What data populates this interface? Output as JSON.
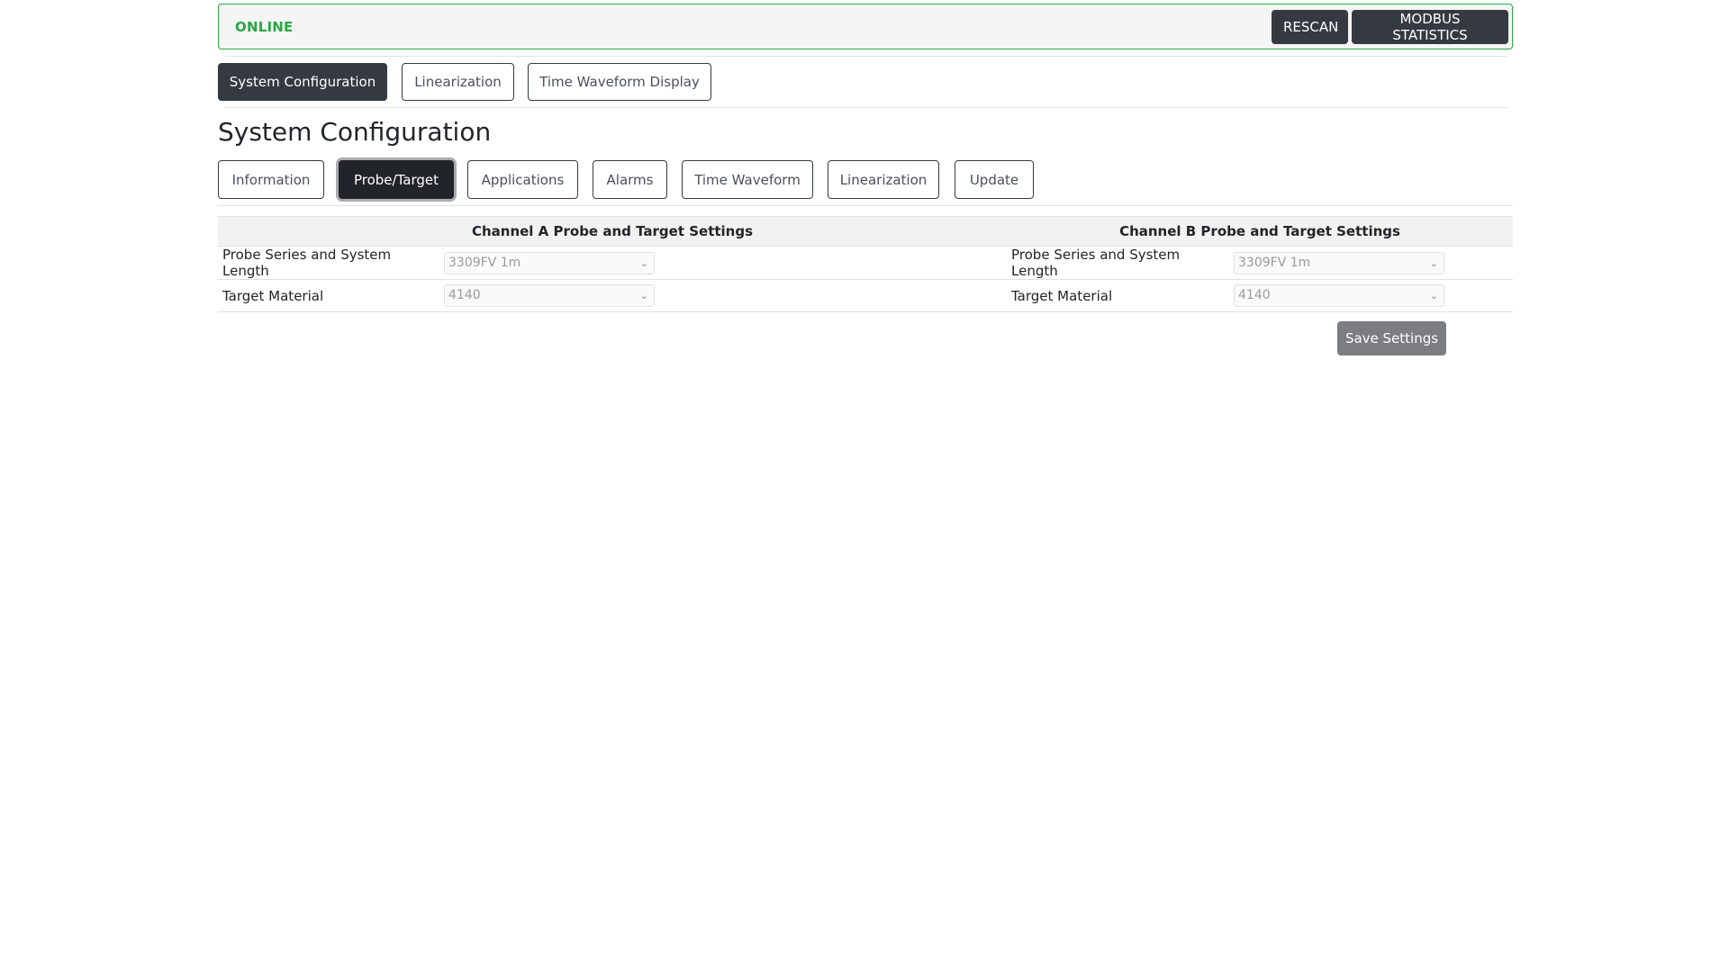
{
  "status": {
    "text": "ONLINE",
    "color": "#28a745",
    "buttons": {
      "rescan": "RESCAN",
      "modbus_statistics": "MODBUS STATISTICS"
    }
  },
  "main_nav": {
    "tabs": [
      {
        "label": "System Configuration",
        "active": true
      },
      {
        "label": "Linearization",
        "active": false
      },
      {
        "label": "Time Waveform Display",
        "active": false
      }
    ]
  },
  "page": {
    "title": "System Configuration"
  },
  "sub_nav": {
    "tabs": [
      {
        "label": "Information",
        "active": false
      },
      {
        "label": "Probe/Target",
        "active": true
      },
      {
        "label": "Applications",
        "active": false
      },
      {
        "label": "Alarms",
        "active": false
      },
      {
        "label": "Time Waveform",
        "active": false
      },
      {
        "label": "Linearization",
        "active": false
      },
      {
        "label": "Update",
        "active": false
      }
    ]
  },
  "settings": {
    "channel_a": {
      "header": "Channel A Probe and Target Settings",
      "rows": [
        {
          "label": "Probe Series and System Length",
          "value": "3309FV 1m"
        },
        {
          "label": "Target Material",
          "value": "4140"
        }
      ]
    },
    "channel_b": {
      "header": "Channel B Probe and Target Settings",
      "rows": [
        {
          "label": "Probe Series and System Length",
          "value": "3309FV 1m"
        },
        {
          "label": "Target Material",
          "value": "4140"
        }
      ]
    },
    "save_label": "Save Settings"
  },
  "icons": {
    "chevron": "⌄"
  }
}
